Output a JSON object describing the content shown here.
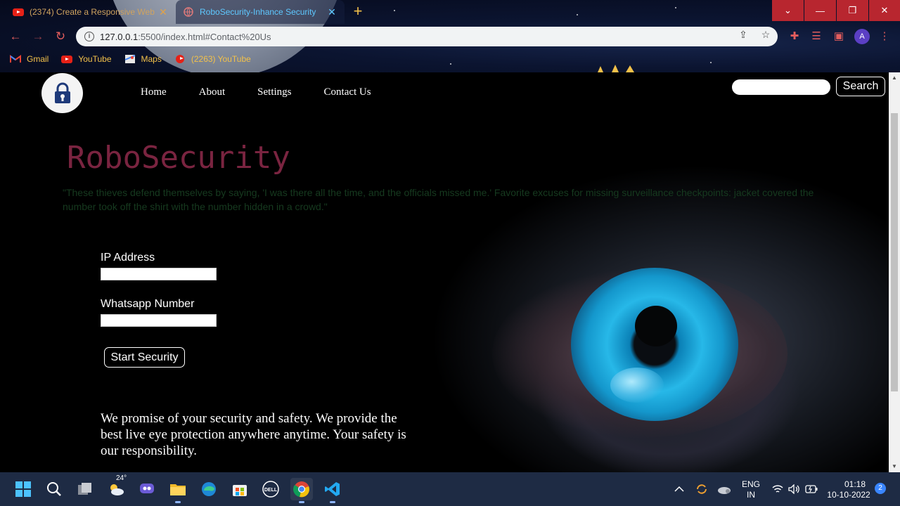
{
  "browser": {
    "tabs": [
      {
        "title": "(2374) Create a Responsive Web",
        "icon": "youtube-icon",
        "active": false
      },
      {
        "title": "RoboSecurity-Inhance Security",
        "icon": "globe-icon",
        "active": true
      }
    ],
    "url_host": "127.0.0.1",
    "url_path": ":5500/index.html#Contact%20Us",
    "profile_initial": "A",
    "bookmarks": [
      {
        "label": "Gmail",
        "icon": "gmail-icon"
      },
      {
        "label": "YouTube",
        "icon": "youtube-icon"
      },
      {
        "label": "Maps",
        "icon": "maps-icon"
      },
      {
        "label": "(2263) YouTube",
        "icon": "youtube-icon"
      }
    ]
  },
  "page": {
    "nav": [
      "Home",
      "About",
      "Settings",
      "Contact Us"
    ],
    "search_button": "Search",
    "brand": "RoboSecurity",
    "quote": "\"These thieves defend themselves by saying, 'I was there all the time, and the officials missed me.' Favorite excuses for missing surveillance checkpoints: jacket covered the number took off the shirt with the number hidden in a crowd.\"",
    "form": {
      "ip_label": "IP Address",
      "whatsapp_label": "Whatsapp Number",
      "start_button": "Start Security"
    },
    "promise": "We promise of your security and safety. We provide the best live eye protection anywhere anytime. Your safety is our responsibility."
  },
  "taskbar": {
    "weather_temp": "24°",
    "lang_top": "ENG",
    "lang_bottom": "IN",
    "time": "01:18",
    "date": "10-10-2022",
    "notifications": "2"
  },
  "colors": {
    "brand": "#7a2440",
    "quote": "#163a1f",
    "tab_active_text": "#5ec8ff",
    "tab_inactive_text": "#d0a35f",
    "window_controls": "#b8262f"
  }
}
